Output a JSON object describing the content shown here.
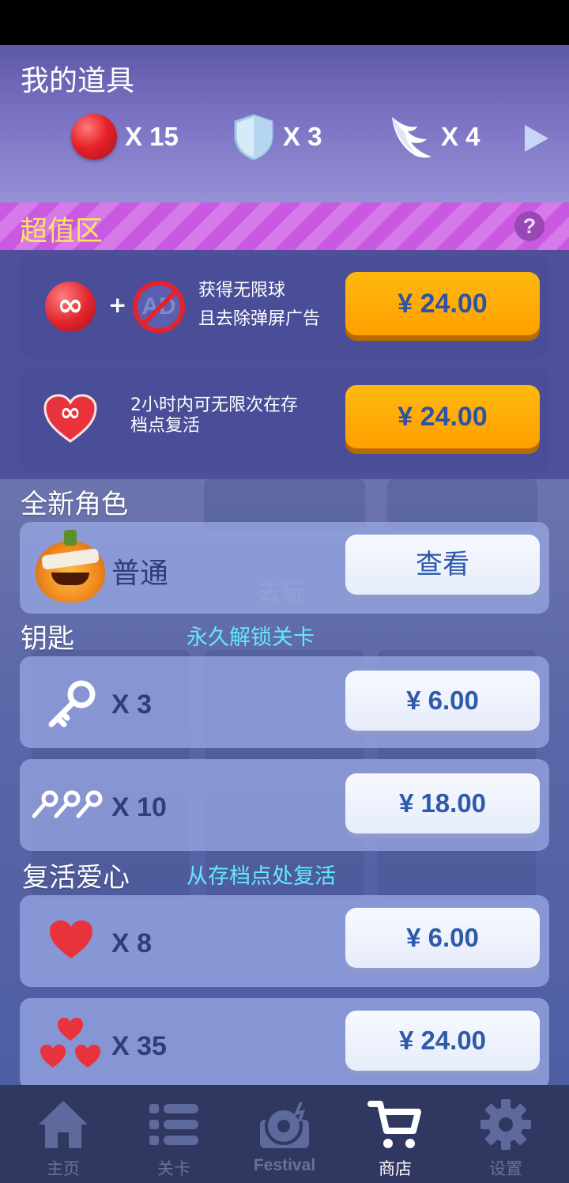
{
  "my_items": {
    "title": "我的道具",
    "balls_count": "X 15",
    "shields_count": "X 3",
    "wings_count": "X 4"
  },
  "super_value": {
    "title": "超值区",
    "help": "?",
    "offer1": {
      "infinity_symbol": "∞",
      "plus": "+",
      "ad_text": "AD",
      "line1": "获得无限球",
      "line2": "且去除弹屏广告",
      "price": "¥ 24.00"
    },
    "offer2": {
      "infinity_symbol": "∞",
      "line1": "2小时内可无限次在存",
      "line2": "档点复活",
      "price": "¥ 24.00"
    }
  },
  "new_role": {
    "title": "全新角色",
    "name": "普通",
    "button": "查看"
  },
  "keys": {
    "title": "钥匙",
    "subtitle": "永久解锁关卡",
    "items": [
      {
        "count": "X 3",
        "price": "¥ 6.00"
      },
      {
        "count": "X 10",
        "price": "¥ 18.00"
      }
    ]
  },
  "hearts": {
    "title": "复活爱心",
    "subtitle": "从存档点处复活",
    "items": [
      {
        "count": "X 8",
        "price": "¥ 6.00"
      },
      {
        "count": "X 35",
        "price": "¥ 24.00"
      }
    ]
  },
  "background_ghost_text": {
    "play": "去玩"
  },
  "nav": {
    "home": "主页",
    "levels": "关卡",
    "festival": "Festival",
    "shop": "商店",
    "settings": "设置"
  },
  "colors": {
    "accent_gold": "#ffa000",
    "price_text": "#2d52a6",
    "super_title": "#ffe55a",
    "subtitle_cyan": "#64e8ff",
    "nav_bg": "#303761"
  }
}
